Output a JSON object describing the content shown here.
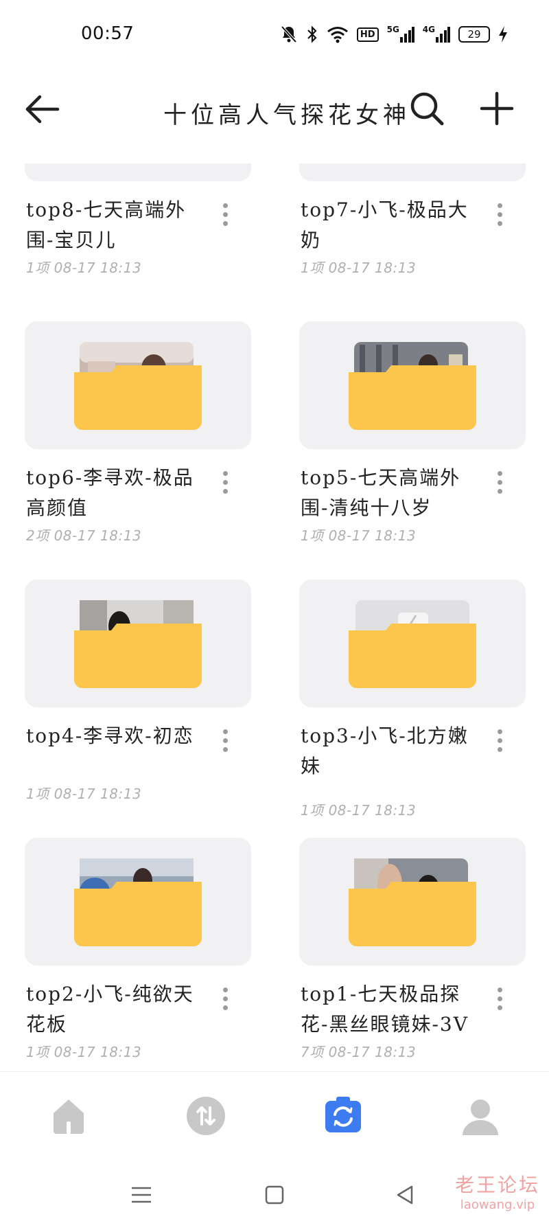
{
  "status_bar": {
    "time": "00:57",
    "icons": [
      "bell-off-icon",
      "bluetooth-icon",
      "wifi-icon",
      "hd-icon",
      "signal-5g-icon",
      "signal-4g-icon",
      "battery-icon",
      "charging-icon"
    ],
    "hd_label": "HD",
    "net1_label": "5G",
    "net2_label": "4G",
    "battery_level": "29"
  },
  "header": {
    "title": "十位高人气探花女神"
  },
  "folders": [
    {
      "name": "top8-七天高端外围-宝贝儿",
      "meta": "1项 08-17 18:13",
      "thumb": "partial"
    },
    {
      "name": "top7-小飞-极品大奶",
      "meta": "1项 08-17 18:13",
      "thumb": "partial"
    },
    {
      "name": "top6-李寻欢-极品高颜值",
      "meta": "2项 08-17 18:13",
      "thumb": "photo"
    },
    {
      "name": "top5-七天高端外围-清纯十八岁",
      "meta": "1项 08-17 18:13",
      "thumb": "photo"
    },
    {
      "name": "top4-李寻欢-初恋",
      "meta": "1项 08-17 18:13",
      "thumb": "photo"
    },
    {
      "name": "top3-小飞-北方嫩妹",
      "meta": "1项 08-17 18:13",
      "thumb": "broken"
    },
    {
      "name": "top2-小飞-纯欲天花板",
      "meta": "1项 08-17 18:13",
      "thumb": "photo"
    },
    {
      "name": "top1-七天极品探花-黑丝眼镜妹-3V",
      "meta": "7项 08-17 18:13",
      "thumb": "photo"
    }
  ],
  "bottom_nav": {
    "items": [
      {
        "icon": "home-icon",
        "active": false
      },
      {
        "icon": "transfer-icon",
        "active": false
      },
      {
        "icon": "files-icon",
        "active": true
      },
      {
        "icon": "profile-icon",
        "active": false
      }
    ]
  },
  "watermark": {
    "text": "老王论坛",
    "url": "laowang.vip"
  },
  "colors": {
    "folder_yellow": "#fcc64d",
    "card_bg": "#f1f1f3",
    "nav_active": "#3d7cf0",
    "nav_inactive": "#c8c8c8"
  }
}
